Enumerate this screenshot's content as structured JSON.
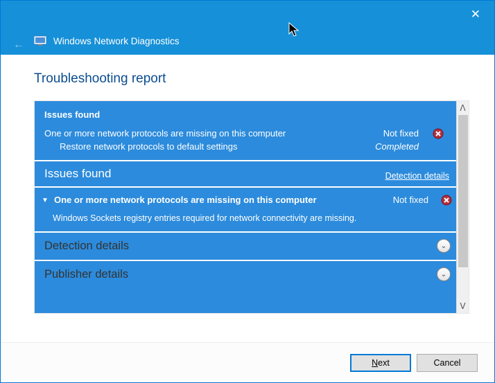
{
  "window": {
    "app_title": "Windows Network Diagnostics"
  },
  "heading": "Troubleshooting report",
  "report": {
    "summary": {
      "header": "Issues found",
      "issue_text": "One or more network protocols are missing on this computer",
      "issue_status": "Not fixed",
      "action_text": "Restore network protocols to default settings",
      "action_status": "Completed"
    },
    "issues_title": "Issues found",
    "detection_link": "Detection details",
    "expanded": {
      "title": "One or more network protocols are missing on this computer",
      "status": "Not fixed",
      "description": "Windows Sockets registry entries required for network connectivity are missing."
    },
    "detection_section": "Detection details",
    "publisher_section": "Publisher details"
  },
  "footer": {
    "next_prefix": "N",
    "next_rest": "ext",
    "cancel": "Cancel"
  }
}
